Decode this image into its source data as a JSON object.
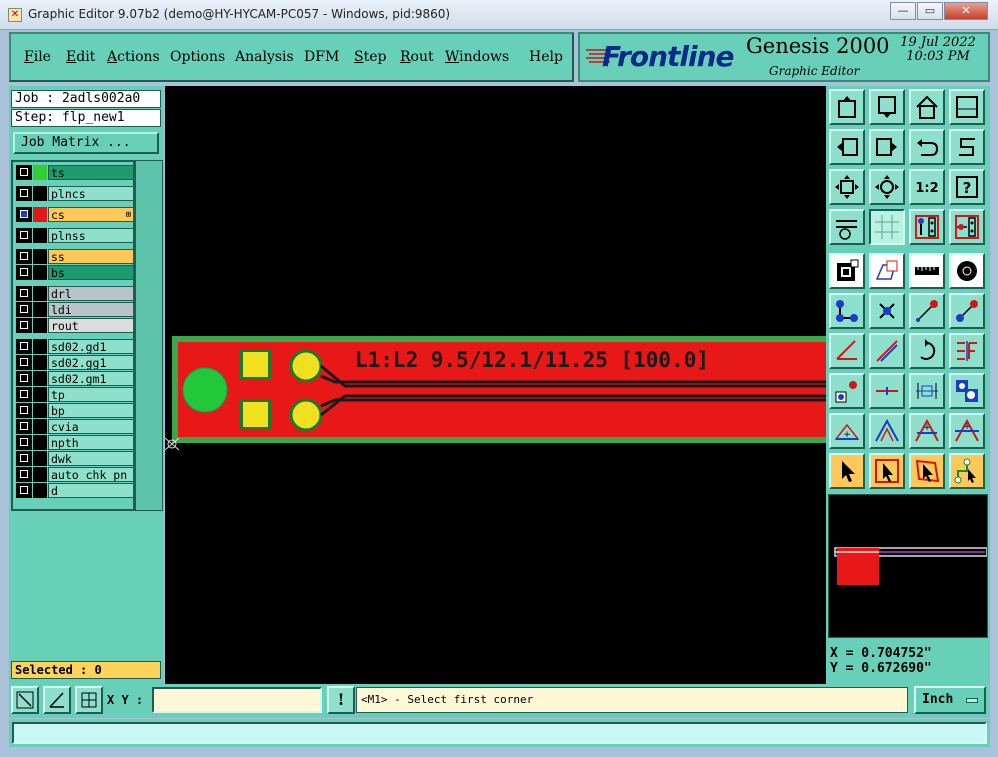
{
  "window": {
    "title": "Graphic Editor 9.07b2 (demo@HY-HYCAM-PC057 - Windows, pid:9860)",
    "controls": {
      "minimize": "—",
      "maximize": "▭",
      "close": "✕"
    }
  },
  "menu": {
    "items": [
      "File",
      "Edit",
      "Actions",
      "Options",
      "Analysis",
      "DFM",
      "Step",
      "Rout",
      "Windows",
      "Help"
    ]
  },
  "brand": {
    "logo": "Frontline",
    "product": "Genesis 2000",
    "subtitle": "Graphic Editor",
    "date": "19 Jul 2022",
    "time": "10:03 PM"
  },
  "left": {
    "job": "Job : 2adls002a0",
    "step": "Step: flp_new1",
    "job_matrix": "Job Matrix ...",
    "selected": "Selected : 0",
    "layers": [
      {
        "name": "ts",
        "bg": "#1f9a6e",
        "swatch": "#33cc33",
        "checked": false
      },
      {
        "name": "plncs",
        "bg": "#8ee0cc",
        "swatch": "#000000",
        "checked": false
      },
      {
        "name": "cs",
        "bg": "#ffc85a",
        "swatch": "#e01818",
        "checked": true,
        "mark": "⊞"
      },
      {
        "name": "plnss",
        "bg": "#8ee0cc",
        "swatch": "#000000",
        "checked": false
      },
      {
        "name": "ss",
        "bg": "#ffc85a",
        "swatch": "#000000",
        "checked": false
      },
      {
        "name": "bs",
        "bg": "#1f9a6e",
        "swatch": "#000000",
        "checked": false
      },
      {
        "name": "drl",
        "bg": "#b8c4c8",
        "swatch": "#000000",
        "checked": false
      },
      {
        "name": "ldi",
        "bg": "#b8c4c8",
        "swatch": "#000000",
        "checked": false
      },
      {
        "name": "rout",
        "bg": "#dcdcdc",
        "swatch": "#000000",
        "checked": false
      },
      {
        "name": "sd02.gd1",
        "bg": "#8ee0cc",
        "swatch": "#000000",
        "checked": false
      },
      {
        "name": "sd02.gg1",
        "bg": "#8ee0cc",
        "swatch": "#000000",
        "checked": false
      },
      {
        "name": "sd02.gm1",
        "bg": "#8ee0cc",
        "swatch": "#000000",
        "checked": false
      },
      {
        "name": "tp",
        "bg": "#8ee0cc",
        "swatch": "#000000",
        "checked": false
      },
      {
        "name": "bp",
        "bg": "#8ee0cc",
        "swatch": "#000000",
        "checked": false
      },
      {
        "name": "cvia",
        "bg": "#8ee0cc",
        "swatch": "#000000",
        "checked": false
      },
      {
        "name": "npth",
        "bg": "#8ee0cc",
        "swatch": "#000000",
        "checked": false
      },
      {
        "name": "dwk",
        "bg": "#8ee0cc",
        "swatch": "#000000",
        "checked": false
      },
      {
        "name": "auto_chk_pn",
        "bg": "#8ee0cc",
        "swatch": "#000000",
        "checked": false
      },
      {
        "name": "d",
        "bg": "#8ee0cc",
        "swatch": "#000000",
        "checked": false
      }
    ]
  },
  "canvas": {
    "board_label": "L1:L2 9.5/12.1/11.25 [100.0]",
    "colors": {
      "board": "#e81818",
      "outline": "#3aa84a",
      "pad": "#f0e020",
      "via": "#22c83a"
    }
  },
  "tools": {
    "rows": [
      [
        "move-up-icon",
        "move-down-icon",
        "home-icon",
        "window-icon"
      ],
      [
        "left-icon",
        "right-icon",
        "undo-icon",
        "step-icon"
      ],
      [
        "fit-icon",
        "center-icon",
        "scale-1-2-icon",
        "help-icon"
      ],
      [
        "measure-icon",
        "grid-icon",
        "layers-red-icon",
        "layers-red-2-icon"
      ],
      [
        "snap-icon",
        "shape-icon",
        "ruler-icon",
        "pad-icon"
      ],
      [
        "net-icon",
        "cross-icon",
        "line-dot-icon",
        "line-blue-icon"
      ],
      [
        "angle-red-icon",
        "angle-blue-icon",
        "rotate-icon",
        "split-icon"
      ],
      [
        "points-icon",
        "dash-icon",
        "center-mark-icon",
        "box-blue-icon"
      ],
      [
        "arc-red-icon",
        "arc-blue-icon",
        "arc-up-icon",
        "arc-x-icon"
      ],
      [
        "pointer-icon",
        "select-box-icon",
        "select-poly-icon",
        "select-net-icon"
      ]
    ],
    "scale_label": "1:2",
    "help_label": "?"
  },
  "coords": {
    "x": "X = 0.704752\"",
    "y": "Y = 0.672690\""
  },
  "bottom": {
    "xy_label": "X Y :",
    "xy_value": "",
    "warn": "!",
    "prompt": "<M1> - Select first corner",
    "unit": "Inch"
  },
  "status": ""
}
